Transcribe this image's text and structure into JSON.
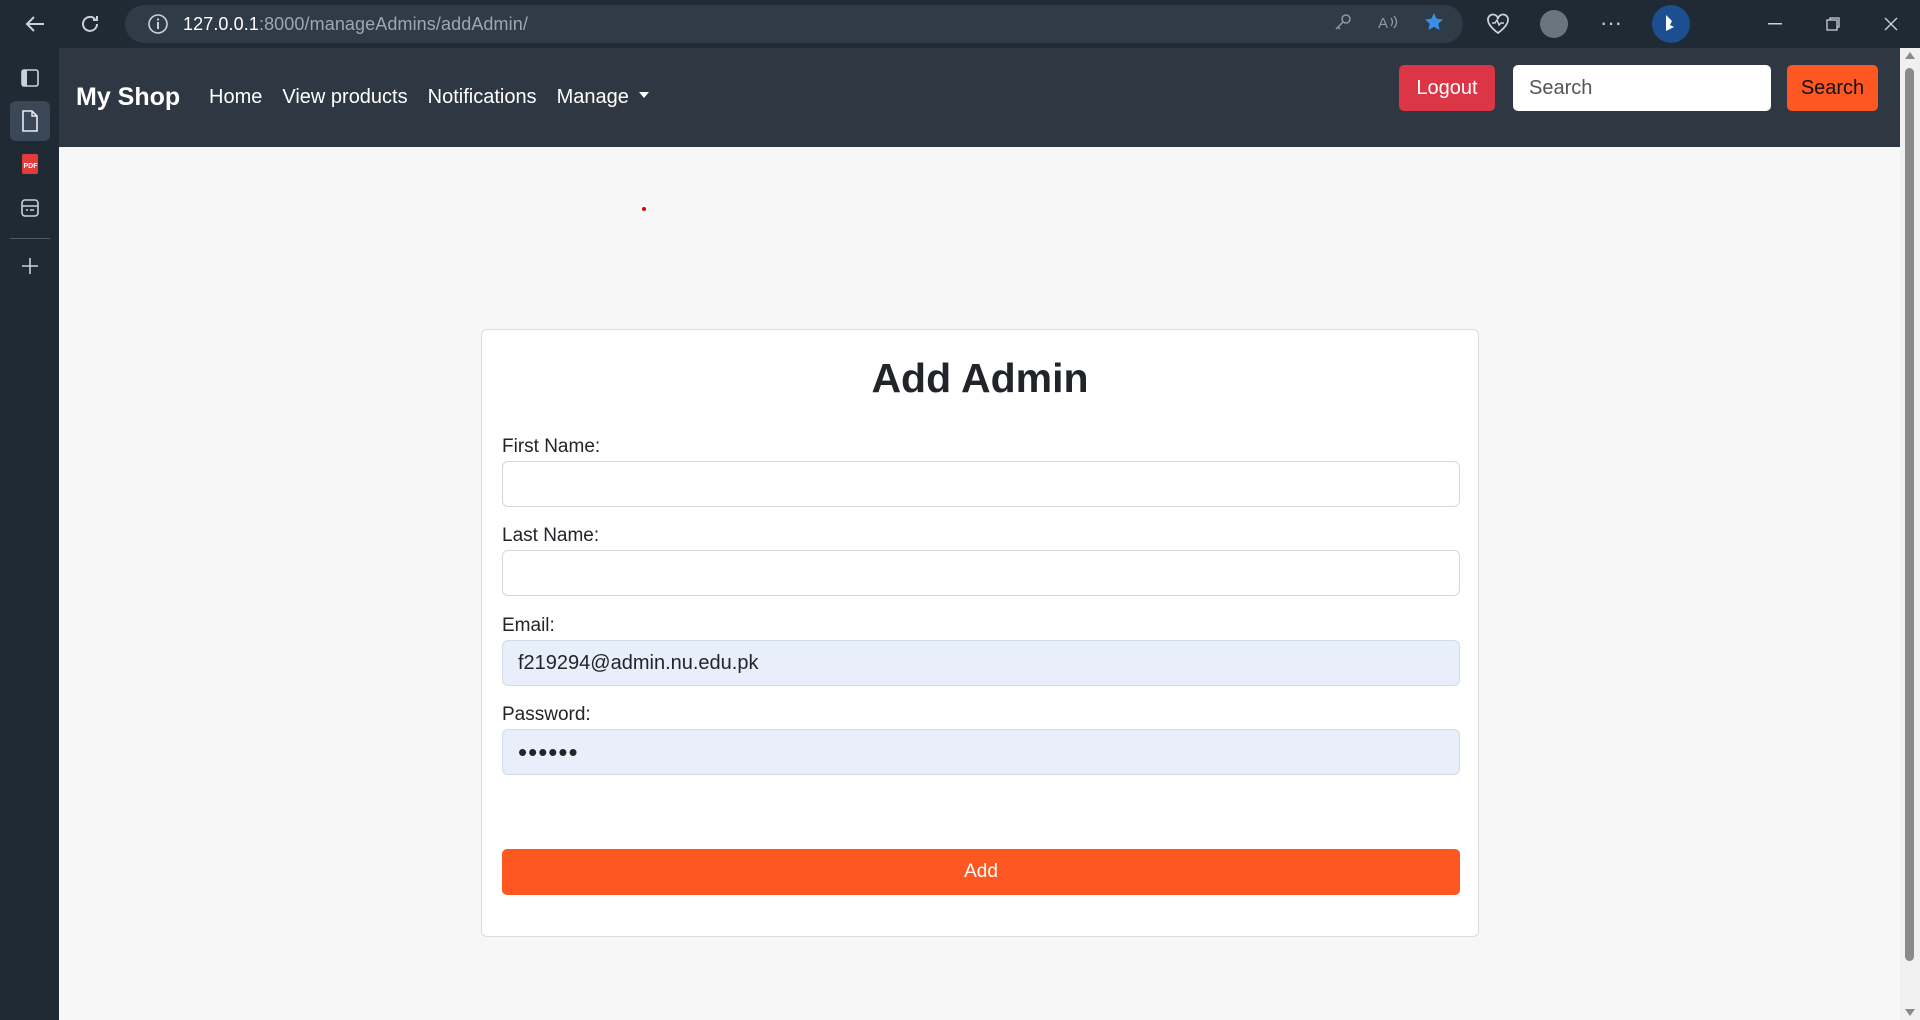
{
  "browser": {
    "url_host": "127.0.0.1",
    "url_path": ":8000/manageAdmins/addAdmin/"
  },
  "navbar": {
    "brand": "My Shop",
    "links": [
      "Home",
      "View products",
      "Notifications",
      "Manage"
    ],
    "logout_label": "Logout",
    "search_placeholder": "Search",
    "search_button_label": "Search"
  },
  "form": {
    "title": "Add Admin",
    "first_name_label": "First Name:",
    "first_name_value": "",
    "last_name_label": "Last Name:",
    "last_name_value": "",
    "email_label": "Email:",
    "email_value": "f219294@admin.nu.edu.pk",
    "password_label": "Password:",
    "password_value": "••••••",
    "submit_label": "Add"
  },
  "colors": {
    "navbar_bg": "#2f3742",
    "accent_orange": "#fe5722",
    "logout_red": "#dc3545",
    "autofill_bg": "#e8effa"
  }
}
